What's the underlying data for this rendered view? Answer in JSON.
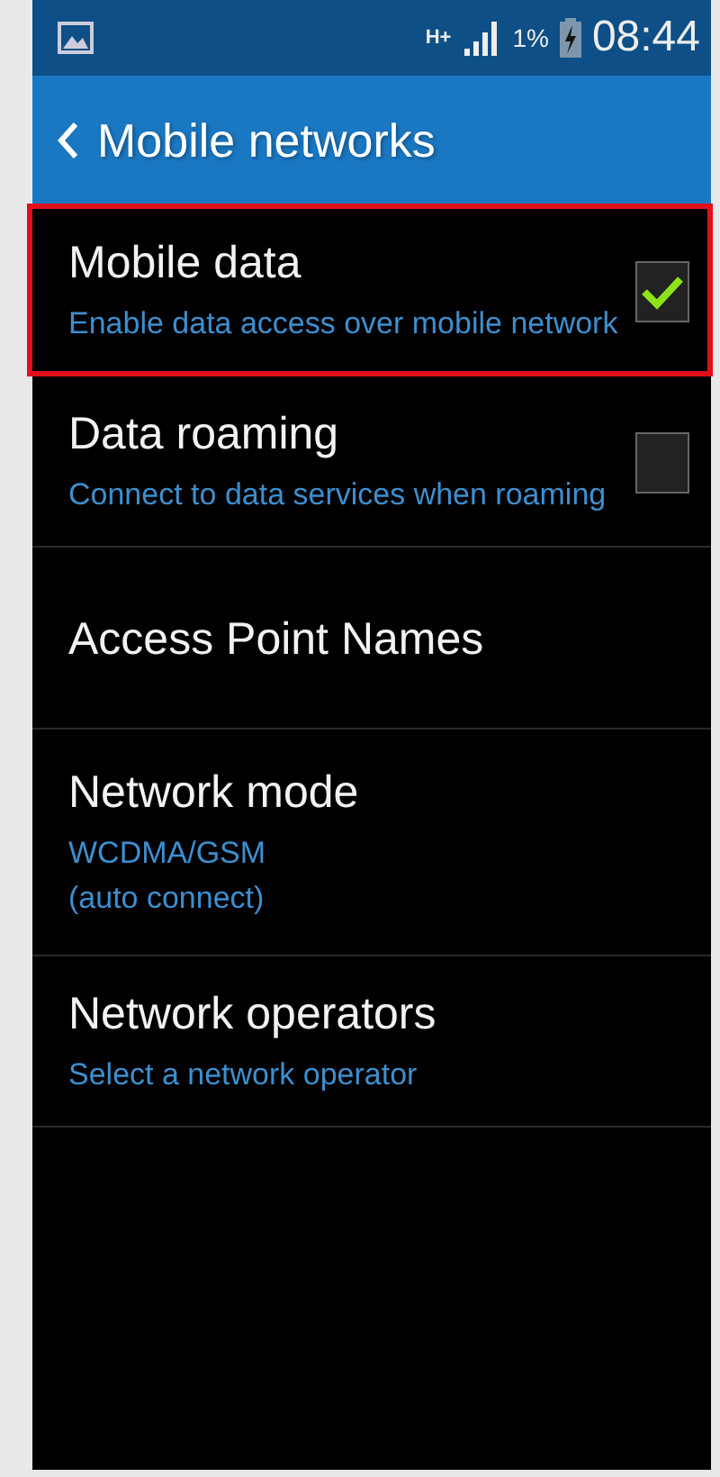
{
  "status_bar": {
    "network_type": "H+",
    "battery_percent": "1%",
    "time": "08:44"
  },
  "action_bar": {
    "title": "Mobile networks"
  },
  "items": [
    {
      "kind": "checkbox",
      "title": "Mobile data",
      "summary": "Enable data access over mobile network",
      "checked": true,
      "highlighted": true
    },
    {
      "kind": "checkbox",
      "title": "Data roaming",
      "summary": "Connect to data services when roaming",
      "checked": false,
      "highlighted": false
    },
    {
      "kind": "plain",
      "title": "Access Point Names",
      "highlighted": false
    },
    {
      "kind": "plain",
      "title": "Network mode",
      "summary": "WCDMA/GSM\n(auto connect)",
      "highlighted": false
    },
    {
      "kind": "plain",
      "title": "Network operators",
      "summary": "Select a network operator",
      "highlighted": false
    }
  ]
}
